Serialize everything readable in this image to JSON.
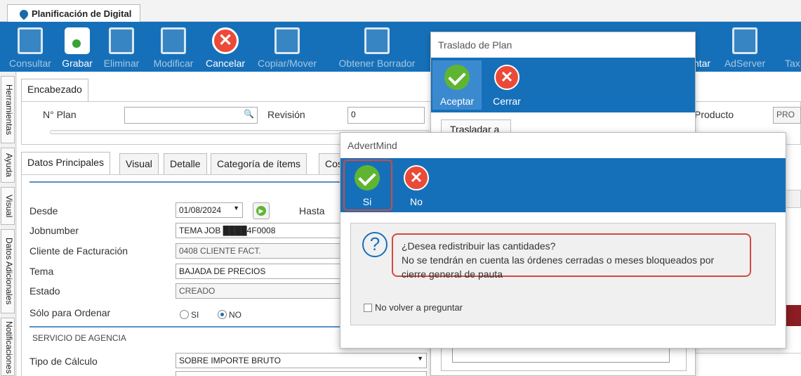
{
  "window": {
    "tab_title": "Planificación de Digital"
  },
  "ribbon": {
    "buttons": [
      {
        "label": "Consultar",
        "enabled": false
      },
      {
        "label": "Grabar",
        "enabled": true
      },
      {
        "label": "Eliminar",
        "enabled": false
      },
      {
        "label": "Modificar",
        "enabled": false
      },
      {
        "label": "Cancelar",
        "enabled": true
      },
      {
        "label": "Copiar/Mover",
        "enabled": false
      },
      {
        "label": "Obtener Borrador",
        "enabled": false
      },
      {
        "label": "ntar",
        "enabled": true
      },
      {
        "label": "AdServer",
        "enabled": false
      },
      {
        "label": "Tax",
        "enabled": false
      }
    ]
  },
  "sidebar": {
    "tabs": [
      "Herramientas",
      "Ayuda",
      "Visual",
      "Datos Adicionales",
      "Notificaciones"
    ]
  },
  "encabezado": {
    "tab": "Encabezado",
    "plan_label": "N° Plan",
    "plan_value": "",
    "revision_label": "Revisión",
    "revision_value": "0",
    "producto_label": "Producto",
    "producto_value": "PRO"
  },
  "tabs": [
    "Datos Principales",
    "Visual",
    "Detalle",
    "Categoría de ítems",
    "Cos"
  ],
  "form": {
    "desde_label": "Desde",
    "desde_value": "01/08/2024",
    "hasta_label": "Hasta",
    "jobnumber_label": "Jobnumber",
    "jobnumber_value": "TEMA JOB ████4F0008",
    "cliente_label": "Cliente de Facturación",
    "cliente_value": "0408 CLIENTE FACT.",
    "tema_label": "Tema",
    "tema_value": "BAJADA DE PRECIOS",
    "estado_label": "Estado",
    "estado_value": "CREADO",
    "solo_label": "Sólo para Ordenar",
    "radio_si": "SI",
    "radio_no": "NO",
    "section_agencia": "SERVICIO DE AGENCIA",
    "calculo_label": "Tipo de Cálculo",
    "calculo_value": "SOBRE IMPORTE BRUTO"
  },
  "dialog_traslado": {
    "title": "Traslado de Plan",
    "accept_label": "Aceptar",
    "close_label": "Cerrar",
    "trasladar_label": "Trasladar a"
  },
  "dialog_confirm": {
    "title": "AdvertMind",
    "yes_label": "Si",
    "no_label": "No",
    "message_line1": "¿Desea redistribuir las cantidades?",
    "message_line2": "No se tendrán en cuenta las órdenes cerradas o meses bloqueados por",
    "message_line3": "cierre general de pauta",
    "checkbox_label": "No volver a preguntar"
  },
  "colors": {
    "ribbon": "#1670b9",
    "ok": "#5fb531",
    "cancel": "#ea4a37",
    "highlight": "#d4493f"
  }
}
